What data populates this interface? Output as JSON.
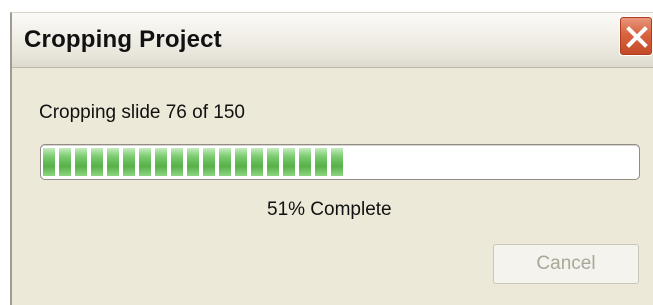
{
  "window": {
    "title": "Cropping Project"
  },
  "status": {
    "text": "Cropping slide 76 of 150"
  },
  "progress": {
    "fraction": 0.51,
    "percent_text": "51% Complete"
  },
  "buttons": {
    "cancel_label": "Cancel",
    "cancel_enabled": false
  },
  "icons": {
    "close": "close-icon"
  },
  "colors": {
    "progress_fill": "#5cb84e",
    "close_button": "#d8653f",
    "dialog_background": "#ece9d8",
    "disabled_text": "#a9a797"
  }
}
